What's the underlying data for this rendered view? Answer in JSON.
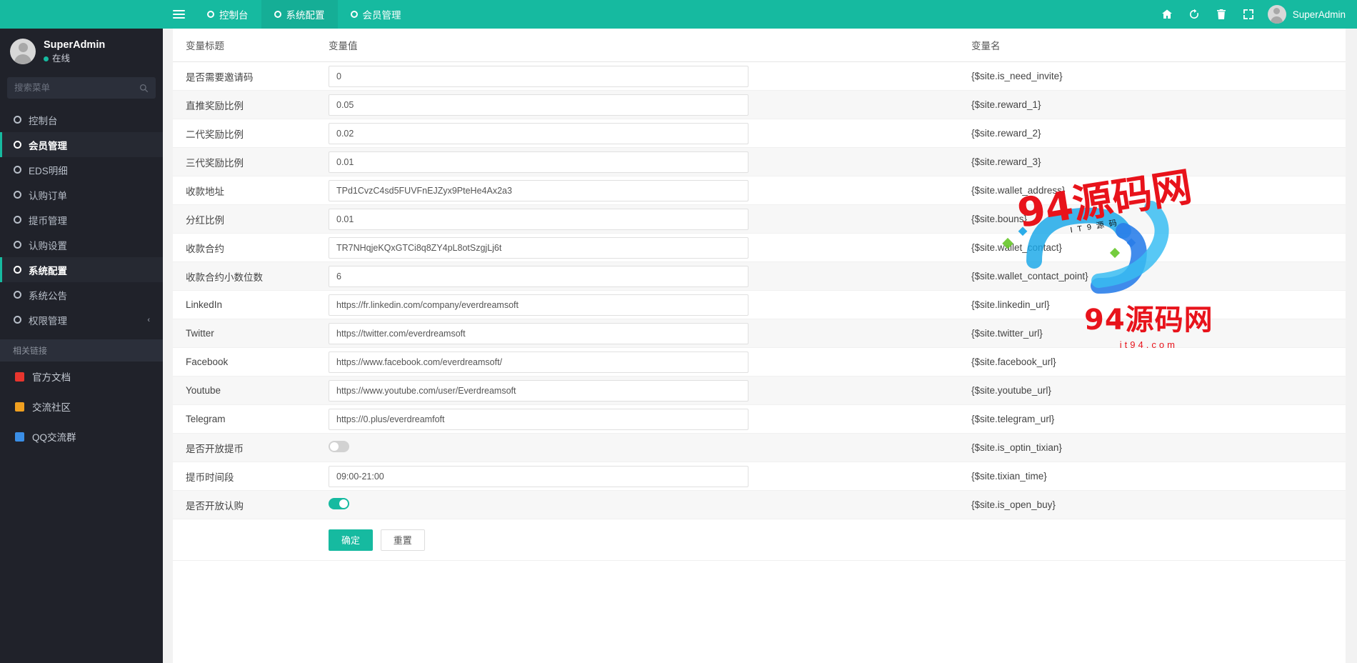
{
  "sidebar": {
    "user": {
      "name": "SuperAdmin",
      "status": "在线"
    },
    "search": {
      "placeholder": "搜索菜单",
      "value": ""
    },
    "items": [
      {
        "label": "控制台",
        "active": false
      },
      {
        "label": "会员管理",
        "active": true
      },
      {
        "label": "EDS明细",
        "active": false
      },
      {
        "label": "认购订单",
        "active": false
      },
      {
        "label": "提币管理",
        "active": false
      },
      {
        "label": "认购设置",
        "active": false
      },
      {
        "label": "系统配置",
        "active": true
      },
      {
        "label": "系统公告",
        "active": false
      },
      {
        "label": "权限管理",
        "active": false,
        "chevron": "‹"
      }
    ],
    "links_title": "相关链接",
    "links": [
      {
        "label": "官方文档",
        "color": "#e8352e",
        "icon": "doc-icon"
      },
      {
        "label": "交流社区",
        "color": "#f0a020",
        "icon": "chat-icon"
      },
      {
        "label": "QQ交流群",
        "color": "#3a8ee6",
        "icon": "penguin-icon"
      }
    ]
  },
  "topbar": {
    "tabs": [
      {
        "label": "控制台",
        "selected": false
      },
      {
        "label": "系统配置",
        "selected": true
      },
      {
        "label": "会员管理",
        "selected": false
      }
    ],
    "icons": [
      "home-icon",
      "refresh-icon",
      "trash-icon",
      "fullscreen-icon"
    ],
    "user": "SuperAdmin"
  },
  "table": {
    "headers": {
      "title": "变量标题",
      "value": "变量值",
      "name": "变量名"
    },
    "rows": [
      {
        "title": "是否需要邀请码",
        "type": "input",
        "value": "0",
        "name": "{$site.is_need_invite}"
      },
      {
        "title": "直推奖励比例",
        "type": "input",
        "value": "0.05",
        "name": "{$site.reward_1}"
      },
      {
        "title": "二代奖励比例",
        "type": "input",
        "value": "0.02",
        "name": "{$site.reward_2}"
      },
      {
        "title": "三代奖励比例",
        "type": "input",
        "value": "0.01",
        "name": "{$site.reward_3}"
      },
      {
        "title": "收款地址",
        "type": "input",
        "value": "TPd1CvzC4sd5FUVFnEJZyx9PteHe4Ax2a3",
        "name": "{$site.wallet_address}"
      },
      {
        "title": "分红比例",
        "type": "input",
        "value": "0.01",
        "name": "{$site.bouns}"
      },
      {
        "title": "收款合约",
        "type": "input",
        "value": "TR7NHqjeKQxGTCi8q8ZY4pL8otSzgjLj6t",
        "name": "{$site.wallet_contact}"
      },
      {
        "title": "收款合约小数位数",
        "type": "input",
        "value": "6",
        "name": "{$site.wallet_contact_point}"
      },
      {
        "title": "LinkedIn",
        "type": "input",
        "value": "https://fr.linkedin.com/company/everdreamsoft",
        "name": "{$site.linkedin_url}"
      },
      {
        "title": "Twitter",
        "type": "input",
        "value": "https://twitter.com/everdreamsoft",
        "name": "{$site.twitter_url}"
      },
      {
        "title": "Facebook",
        "type": "input",
        "value": "https://www.facebook.com/everdreamsoft/",
        "name": "{$site.facebook_url}"
      },
      {
        "title": "Youtube",
        "type": "input",
        "value": "https://www.youtube.com/user/Everdreamsoft",
        "name": "{$site.youtube_url}"
      },
      {
        "title": "Telegram",
        "type": "input",
        "value": "https://0.plus/everdreamfoft",
        "name": "{$site.telegram_url}"
      },
      {
        "title": "是否开放提币",
        "type": "switch",
        "on": false,
        "name": "{$site.is_optin_tixian}"
      },
      {
        "title": "提币时间段",
        "type": "input",
        "value": "09:00-21:00",
        "name": "{$site.tixian_time}"
      },
      {
        "title": "是否开放认购",
        "type": "switch",
        "on": true,
        "name": "{$site.is_open_buy}"
      }
    ],
    "submit_label": "确定",
    "reset_label": "重置"
  },
  "watermark": {
    "text": "94源码网",
    "sub": "IT9源码",
    "site": "it94.com"
  },
  "colors": {
    "accent": "#16baa0",
    "sidebar": "#20222A",
    "sidebar_active": "#262932"
  }
}
